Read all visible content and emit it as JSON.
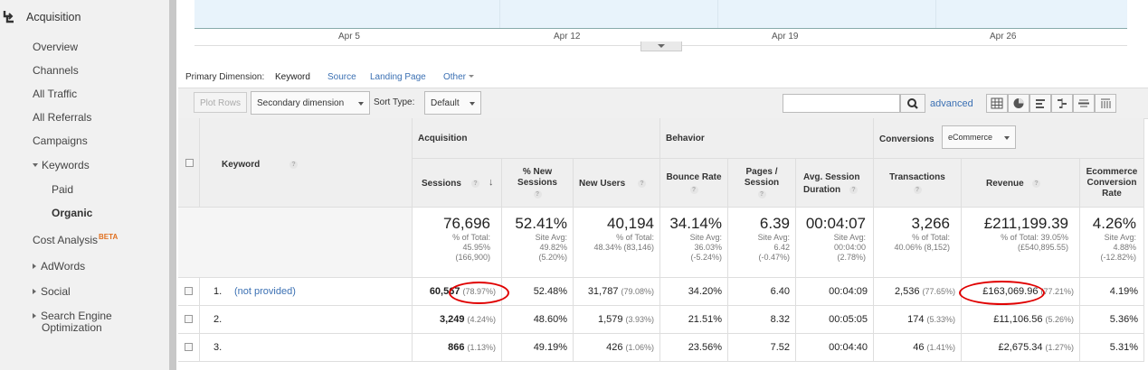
{
  "sidebar": {
    "section_title": "Acquisition",
    "items": {
      "overview": "Overview",
      "channels": "Channels",
      "all_traffic": "All Traffic",
      "all_referrals": "All Referrals",
      "campaigns": "Campaigns",
      "keywords": "Keywords",
      "paid": "Paid",
      "organic": "Organic",
      "cost_analysis": "Cost Analysis",
      "beta": "BETA",
      "adwords": "AdWords",
      "social": "Social",
      "seo": "Search Engine",
      "seo_line2": "Optimization"
    }
  },
  "chart": {
    "x_labels": [
      "Apr 5",
      "Apr 12",
      "Apr 19",
      "Apr 26"
    ]
  },
  "primary_dimension": {
    "label": "Primary Dimension:",
    "selected": "Keyword",
    "options": [
      "Source",
      "Landing Page",
      "Other"
    ]
  },
  "toolbar": {
    "plot_rows": "Plot Rows",
    "secondary_dimension": "Secondary dimension",
    "sort_type_label": "Sort Type:",
    "sort_type_value": "Default",
    "search_value": "",
    "advanced": "advanced"
  },
  "table": {
    "headers": {
      "keyword": "Keyword",
      "acquisition": "Acquisition",
      "behavior": "Behavior",
      "conversions": "Conversions",
      "conversions_select": "eCommerce",
      "sessions": "Sessions",
      "pct_new_sessions_1": "% New",
      "pct_new_sessions_2": "Sessions",
      "new_users": "New Users",
      "bounce_rate": "Bounce Rate",
      "pages_session_1": "Pages /",
      "pages_session_2": "Session",
      "avg_session_1": "Avg. Session",
      "avg_session_2": "Duration",
      "transactions": "Transactions",
      "revenue": "Revenue",
      "ecr_1": "Ecommerce",
      "ecr_2": "Conversion",
      "ecr_3": "Rate"
    },
    "totals": {
      "sessions": {
        "big": "76,696",
        "l1": "% of Total:",
        "l2": "45.95%",
        "l3": "(166,900)"
      },
      "pct_new": {
        "big": "52.41%",
        "l1": "Site Avg:",
        "l2": "49.82%",
        "l3": "(5.20%)"
      },
      "new_users": {
        "big": "40,194",
        "l1": "% of Total:",
        "l2": "48.34% (83,146)"
      },
      "bounce": {
        "big": "34.14%",
        "l1": "Site Avg:",
        "l2": "36.03%",
        "l3": "(-5.24%)"
      },
      "pages": {
        "big": "6.39",
        "l1": "Site Avg:",
        "l2": "6.42",
        "l3": "(-0.47%)"
      },
      "duration": {
        "big": "00:04:07",
        "l1": "Site Avg:",
        "l2": "00:04:00",
        "l3": "(2.78%)"
      },
      "transactions": {
        "big": "3,266",
        "l1": "% of Total:",
        "l2": "40.06% (8,152)"
      },
      "revenue": {
        "big": "£211,199.39",
        "l1": "% of Total: 39.05%",
        "l2": "(£540,895.55)"
      },
      "ecr": {
        "big": "4.26%",
        "l1": "Site Avg:",
        "l2": "4.88%",
        "l3": "(-12.82%)"
      }
    },
    "rows": [
      {
        "index": "1.",
        "keyword": "(not provided)",
        "sessions": "60,567",
        "sessions_pct": "(78.97%)",
        "pct_new": "52.48%",
        "new_users": "31,787",
        "new_users_pct": "(79.08%)",
        "bounce": "34.20%",
        "pages": "6.40",
        "duration": "00:04:09",
        "transactions": "2,536",
        "transactions_pct": "(77.65%)",
        "revenue": "£163,069.96",
        "revenue_pct": "(77.21%)",
        "ecr": "4.19%"
      },
      {
        "index": "2.",
        "keyword": "",
        "sessions": "3,249",
        "sessions_pct": "(4.24%)",
        "pct_new": "48.60%",
        "new_users": "1,579",
        "new_users_pct": "(3.93%)",
        "bounce": "21.51%",
        "pages": "8.32",
        "duration": "00:05:05",
        "transactions": "174",
        "transactions_pct": "(5.33%)",
        "revenue": "£11,106.56",
        "revenue_pct": "(5.26%)",
        "ecr": "5.36%"
      },
      {
        "index": "3.",
        "keyword": "",
        "sessions": "866",
        "sessions_pct": "(1.13%)",
        "pct_new": "49.19%",
        "new_users": "426",
        "new_users_pct": "(1.06%)",
        "bounce": "23.56%",
        "pages": "7.52",
        "duration": "00:04:40",
        "transactions": "46",
        "transactions_pct": "(1.41%)",
        "revenue": "£2,675.34",
        "revenue_pct": "(1.27%)",
        "ecr": "5.31%"
      }
    ]
  },
  "colors": {
    "link": "#3b70b3",
    "highlight_circle": "#e00000",
    "chart_fill": "#e8f3fb",
    "beta": "#e07020"
  }
}
